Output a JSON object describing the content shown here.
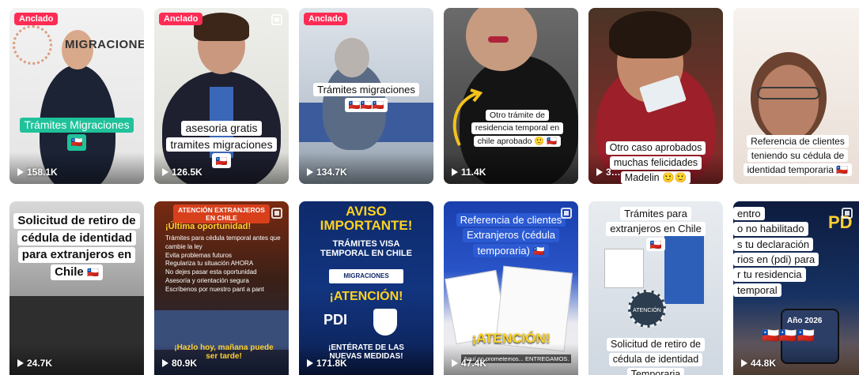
{
  "pinned_label": "Anclado",
  "videos_row1": [
    {
      "views": "158.1K",
      "pinned": true,
      "caption": [
        "Trámites Migraciones"
      ],
      "flag": "🇨🇱",
      "logo_text": "MIGRACIONES"
    },
    {
      "views": "126.5K",
      "pinned": true,
      "caption": [
        "asesoria gratis",
        "tramites migraciones"
      ],
      "flag": "🇨🇱"
    },
    {
      "views": "134.7K",
      "pinned": true,
      "caption": [
        "Trámites migraciones"
      ],
      "flag": "🇨🇱🇨🇱🇨🇱"
    },
    {
      "views": "11.4K",
      "caption": [
        "Otro trámite de",
        "residencia temporal en",
        "chile aprobado 🙂 🇨🇱"
      ]
    },
    {
      "views": "3…",
      "caption": [
        "Otro  caso aprobados",
        "muchas felicidades",
        "Madelin 🙂🙂"
      ]
    },
    {
      "views": "",
      "caption": [
        "Referencia de clientes",
        "teniendo su cédula de",
        "identidad temporaria"
      ],
      "flag": "🇨🇱"
    }
  ],
  "videos_row2": [
    {
      "views": "24.7K",
      "caption": [
        "Solicitud de retiro de",
        "cédula de identidad",
        "para extranjeros en",
        "Chile"
      ],
      "flag": "🇨🇱"
    },
    {
      "views": "80.9K",
      "header": "ATENCIÓN EXTRANJEROS EN CHILE",
      "headline": "¡Última oportunidad!",
      "bullets": [
        "Trámites para cédula temporal antes que cambie la ley",
        "Evita problemas futuros",
        "Regulariza tu situación AHORA",
        "No dejes pasar esta oportunidad",
        "Asesoría y orientación segura",
        "Escríbenos por nuestro pant a pant"
      ],
      "footer": "¡Hazlo hoy, mañana puede ser tarde!"
    },
    {
      "views": "171.8K",
      "title": "AVISO IMPORTANTE!",
      "subtitle": "TRÁMITES VISA TEMPORAL EN CHILE",
      "badge": "MIGRACIONES",
      "attention": "¡ATENCIÓN!",
      "pdi": "PDI",
      "footer": "¡ENTÉRATE DE LAS NUEVAS MEDIDAS!"
    },
    {
      "views": "47.4K",
      "caption": [
        "Referencia de clientes",
        "Extranjeros (cédula",
        "temporaria)"
      ],
      "flag": "🇨🇱",
      "attention": "¡ATENCIÓN!",
      "footer_text": "Aquí no prometemos... ENTREGAMOS."
    },
    {
      "views": "",
      "caption_top": [
        "Trámites para",
        "extranjeros en Chile"
      ],
      "flag": "🇨🇱",
      "caption_bottom": [
        "Solicitud de retiro de",
        "cédula de identidad",
        "Temporaria"
      ],
      "badge": "ATENCIÓN"
    },
    {
      "views": "44.8K",
      "caption": [
        "entro",
        "o no habilitado",
        "s tu declaración",
        "rios en (pdi) para",
        "r tu residencia",
        "temporal"
      ],
      "year": "Año 2026",
      "flags": "🇨🇱🇨🇱🇨🇱"
    }
  ]
}
